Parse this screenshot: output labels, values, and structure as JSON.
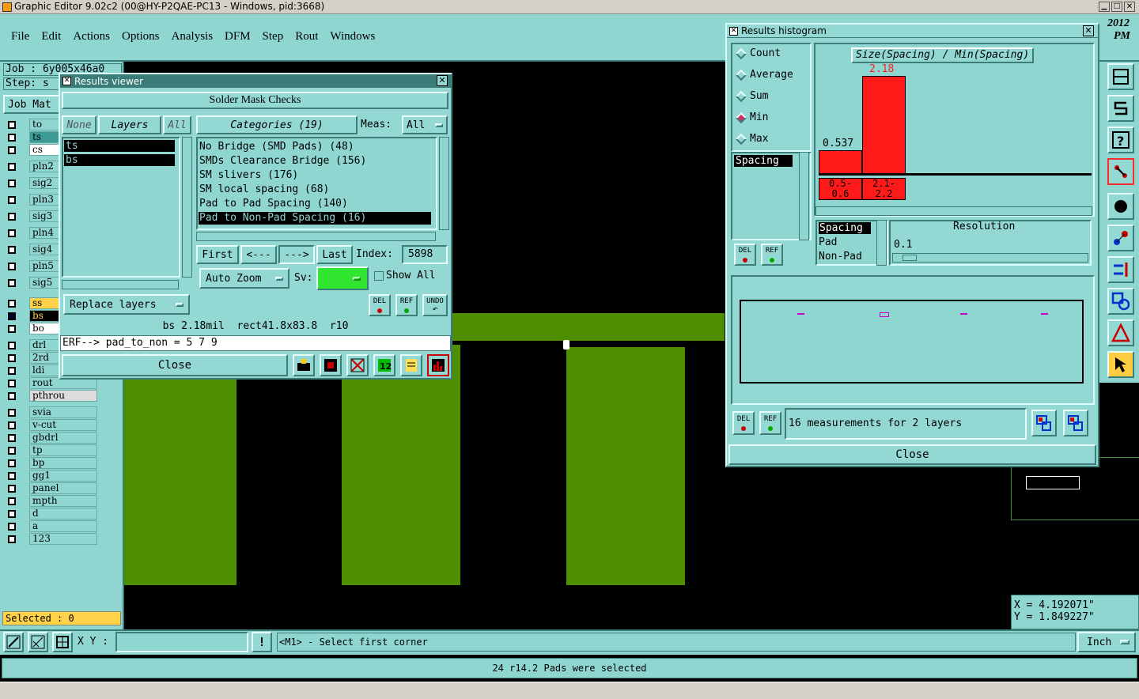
{
  "app": {
    "title": "Graphic Editor 9.02c2 (00@HY-P2QAE-PC13 - Windows, pid:3668)",
    "year": "2012",
    "pm": "PM"
  },
  "menu": [
    "File",
    "Edit",
    "Actions",
    "Options",
    "Analysis",
    "DFM",
    "Step",
    "Rout",
    "Windows"
  ],
  "job": {
    "job_label": "Job : 6y005x46a0",
    "step_label": "Step: s",
    "job_matrix": "Job Mat"
  },
  "layers": [
    "to",
    "ts",
    "cs",
    "pln2",
    "sig2",
    "pln3",
    "sig3",
    "pln4",
    "sig4",
    "pln5",
    "sig5",
    "ss",
    "bs",
    "bo",
    "drl",
    "2rd",
    "ldi",
    "rout",
    "pthrou",
    "svia",
    "v-cut",
    "gbdrl",
    "tp",
    "bp",
    "gg1",
    "panel",
    "mpth",
    "d",
    "a",
    "123"
  ],
  "selected": "Selected : 0",
  "results_viewer": {
    "title": "Results viewer",
    "header": "Solder Mask Checks",
    "none": "None",
    "layers": "Layers",
    "all": "All",
    "categories": "Categories (19)",
    "meas_label": "Meas:",
    "meas_value": "All",
    "layer_items": [
      "ts",
      "bs"
    ],
    "category_items": [
      "No Bridge (SMD Pads) (48)",
      "SMDs Clearance Bridge (156)",
      "SM slivers (176)",
      "SM local spacing (68)",
      "Pad to Pad Spacing (140)",
      "Pad to Non-Pad Spacing (16)"
    ],
    "first": "First",
    "prev": "<---",
    "next": "--->",
    "last": "Last",
    "index_label": "Index:",
    "index_value": "5898",
    "auto_zoom": "Auto Zoom",
    "sv_label": "Sv:",
    "show_all": "Show All",
    "replace_layers": "Replace layers",
    "del": "DEL",
    "ref": "REF",
    "undo": "UNDO",
    "info": "bs 2.18mil  rect41.8x83.8  r10",
    "erf": "ERF--> pad_to_non = 5 7 9",
    "close": "Close"
  },
  "histogram": {
    "title": "Results histogram",
    "options": [
      "Count",
      "Average",
      "Sum",
      "Min",
      "Max"
    ],
    "selected_option": "Min",
    "list_item": "Spacing",
    "chart_title": "Size(Spacing) / Min(Spacing)",
    "bars": [
      {
        "range": "0.5-\n0.6",
        "value": "0.537"
      },
      {
        "range": "2.1-\n2.2",
        "value": "2.18"
      }
    ],
    "types": [
      "Spacing",
      "Pad",
      "Non-Pad"
    ],
    "resolution_label": "Resolution",
    "resolution_value": "0.1",
    "del": "DEL",
    "ref": "REF",
    "summary": "16 measurements for 2 layers",
    "close": "Close"
  },
  "coords": {
    "x": "X = 4.192071\"",
    "y": "Y = 1.849227\""
  },
  "bottom": {
    "xy_label": "X Y :",
    "prompt": "<M1> - Select first corner",
    "unit": "Inch",
    "status": "24 r14.2 Pads were selected"
  },
  "colors": {
    "board": "#4e8f02",
    "panel": "#93d8d3",
    "title": "#3a7d78",
    "highlight": "#ff2a2a",
    "bar": "#ff1a1a",
    "accent": "#ffcc44"
  }
}
